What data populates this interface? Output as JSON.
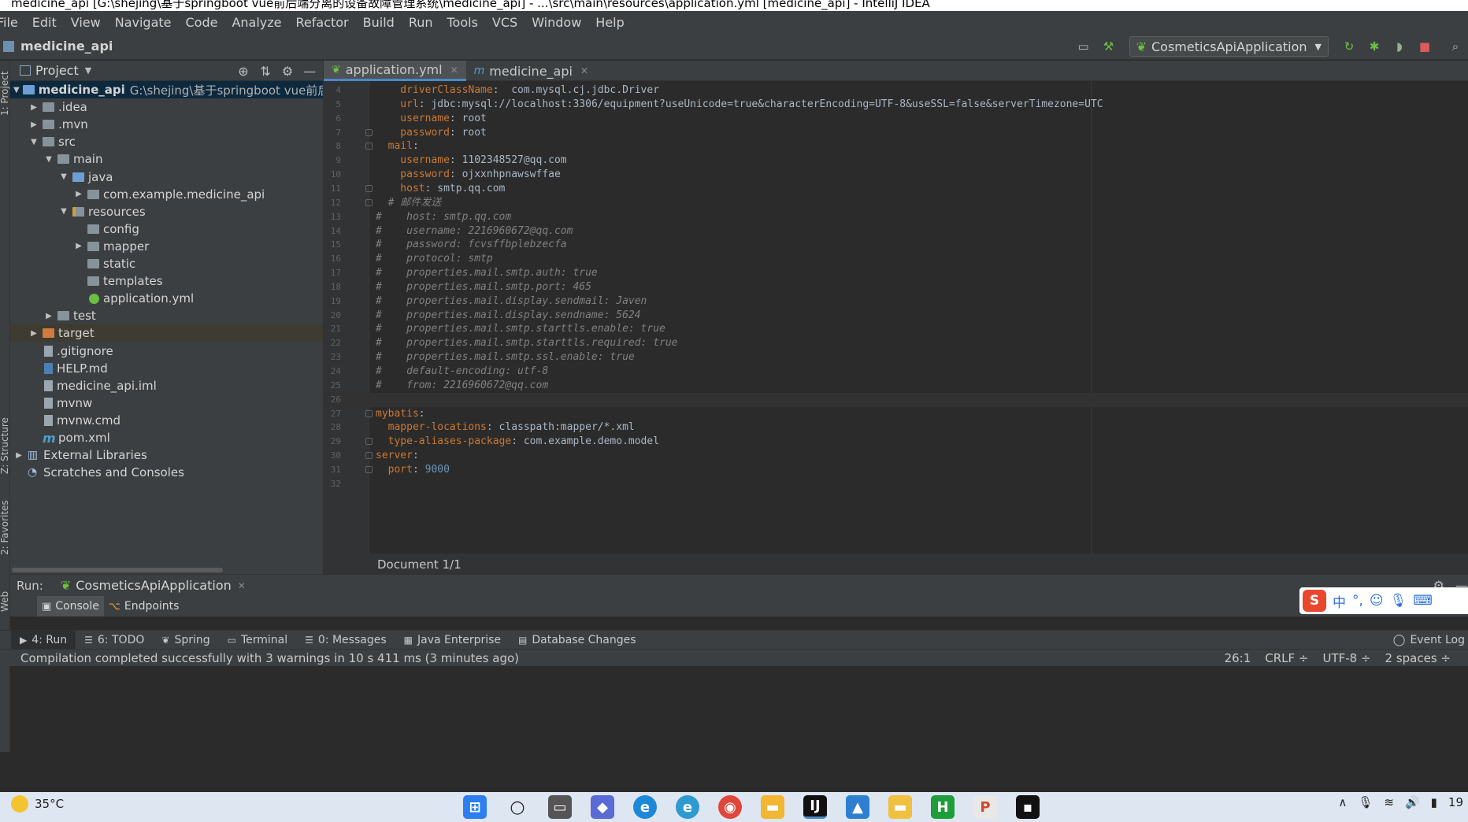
{
  "window": {
    "title": "medicine_api [G:\\shejing\\基于springboot vue前后端分离的设备故障管理系统\\medicine_api] - ...\\src\\main\\resources\\application.yml [medicine_api] - IntelliJ IDEA"
  },
  "menu": [
    "File",
    "Edit",
    "View",
    "Navigate",
    "Code",
    "Analyze",
    "Refactor",
    "Build",
    "Run",
    "Tools",
    "VCS",
    "Window",
    "Help"
  ],
  "nav": {
    "project_name": "medicine_api",
    "run_config": "CosmeticsApiApplication"
  },
  "project_panel": {
    "title": "Project",
    "tree": [
      {
        "label": "medicine_api",
        "path": "G:\\shejing\\基于springboot vue前后端分离的",
        "depth": 0,
        "arrow": "down",
        "icon": "module",
        "selected": true
      },
      {
        "label": ".idea",
        "depth": 1,
        "arrow": "right",
        "icon": "folder"
      },
      {
        "label": ".mvn",
        "depth": 1,
        "arrow": "right",
        "icon": "folder"
      },
      {
        "label": "src",
        "depth": 1,
        "arrow": "down",
        "icon": "folder"
      },
      {
        "label": "main",
        "depth": 2,
        "arrow": "down",
        "icon": "folder"
      },
      {
        "label": "java",
        "depth": 3,
        "arrow": "down",
        "icon": "folder-blue"
      },
      {
        "label": "com.example.medicine_api",
        "depth": 4,
        "arrow": "right",
        "icon": "folder"
      },
      {
        "label": "resources",
        "depth": 3,
        "arrow": "down",
        "icon": "folder-res"
      },
      {
        "label": "config",
        "depth": 4,
        "arrow": "",
        "icon": "folder"
      },
      {
        "label": "mapper",
        "depth": 4,
        "arrow": "right",
        "icon": "folder"
      },
      {
        "label": "static",
        "depth": 4,
        "arrow": "",
        "icon": "folder"
      },
      {
        "label": "templates",
        "depth": 4,
        "arrow": "",
        "icon": "folder"
      },
      {
        "label": "application.yml",
        "depth": 4,
        "arrow": "",
        "icon": "yml"
      },
      {
        "label": "test",
        "depth": 2,
        "arrow": "right",
        "icon": "folder"
      },
      {
        "label": "target",
        "depth": 1,
        "arrow": "right",
        "icon": "folder-orange",
        "highlight": true
      },
      {
        "label": ".gitignore",
        "depth": 1,
        "arrow": "",
        "icon": "file"
      },
      {
        "label": "HELP.md",
        "depth": 1,
        "arrow": "",
        "icon": "md"
      },
      {
        "label": "medicine_api.iml",
        "depth": 1,
        "arrow": "",
        "icon": "file"
      },
      {
        "label": "mvnw",
        "depth": 1,
        "arrow": "",
        "icon": "file"
      },
      {
        "label": "mvnw.cmd",
        "depth": 1,
        "arrow": "",
        "icon": "file"
      },
      {
        "label": "pom.xml",
        "depth": 1,
        "arrow": "",
        "icon": "maven"
      },
      {
        "label": "External Libraries",
        "depth": 0,
        "arrow": "right",
        "icon": "library"
      },
      {
        "label": "Scratches and Consoles",
        "depth": 0,
        "arrow": "",
        "icon": "scratch"
      }
    ]
  },
  "tabs": [
    {
      "label": "application.yml",
      "active": true
    },
    {
      "label": "medicine_api",
      "active": false
    }
  ],
  "editor": {
    "lines": [
      {
        "n": "4",
        "segs": [
          [
            "k",
            "    driverClassName"
          ],
          [
            "v",
            ":  com.mysql.cj.jdbc.Driver"
          ]
        ]
      },
      {
        "n": "5",
        "segs": [
          [
            "k",
            "    url"
          ],
          [
            "v",
            ": jdbc:mysql://localhost:3306/equipment?useUnicode=true&characterEncoding=UTF-8&useSSL=false&serverTimezone=UTC"
          ]
        ]
      },
      {
        "n": "6",
        "segs": [
          [
            "k",
            "    username"
          ],
          [
            "v",
            ": root"
          ]
        ]
      },
      {
        "n": "7",
        "segs": [
          [
            "k",
            "    password"
          ],
          [
            "v",
            ": root"
          ]
        ]
      },
      {
        "n": "8",
        "segs": [
          [
            "k",
            "  mail"
          ],
          [
            "v",
            ":"
          ]
        ]
      },
      {
        "n": "9",
        "segs": [
          [
            "k",
            "    username"
          ],
          [
            "v",
            ": 1102348527@qq.com"
          ]
        ]
      },
      {
        "n": "10",
        "segs": [
          [
            "k",
            "    password"
          ],
          [
            "v",
            ": ojxxnhpnawswffae"
          ]
        ]
      },
      {
        "n": "11",
        "segs": [
          [
            "k",
            "    host"
          ],
          [
            "v",
            ": smtp.qq.com"
          ]
        ]
      },
      {
        "n": "12",
        "segs": [
          [
            "cm",
            "  # 邮件发送"
          ]
        ]
      },
      {
        "n": "13",
        "segs": [
          [
            "cm",
            "#    host: smtp.qq.com"
          ]
        ]
      },
      {
        "n": "14",
        "segs": [
          [
            "cm",
            "#    username: 2216960672@qq.com"
          ]
        ]
      },
      {
        "n": "15",
        "segs": [
          [
            "cm",
            "#    password: fcvsffbplebzecfa"
          ]
        ]
      },
      {
        "n": "16",
        "segs": [
          [
            "cm",
            "#    protocol: smtp"
          ]
        ]
      },
      {
        "n": "17",
        "segs": [
          [
            "cm",
            "#    properties.mail.smtp.auth: true"
          ]
        ]
      },
      {
        "n": "18",
        "segs": [
          [
            "cm",
            "#    properties.mail.smtp.port: 465"
          ]
        ]
      },
      {
        "n": "19",
        "segs": [
          [
            "cm",
            "#    properties.mail.display.sendmail: Javen"
          ]
        ]
      },
      {
        "n": "20",
        "segs": [
          [
            "cm",
            "#    properties.mail.display.sendname: 5624"
          ]
        ]
      },
      {
        "n": "21",
        "segs": [
          [
            "cm",
            "#    properties.mail.smtp.starttls.enable: true"
          ]
        ]
      },
      {
        "n": "22",
        "segs": [
          [
            "cm",
            "#    properties.mail.smtp.starttls.required: true"
          ]
        ]
      },
      {
        "n": "23",
        "segs": [
          [
            "cm",
            "#    properties.mail.smtp.ssl.enable: true"
          ]
        ]
      },
      {
        "n": "24",
        "segs": [
          [
            "cm",
            "#    default-encoding: utf-8"
          ]
        ]
      },
      {
        "n": "25",
        "segs": [
          [
            "cm",
            "#    from: 2216960672@qq.com"
          ]
        ]
      },
      {
        "n": "26",
        "segs": [],
        "current": true
      },
      {
        "n": "27",
        "segs": [
          [
            "k",
            "mybatis"
          ],
          [
            "v",
            ":"
          ]
        ]
      },
      {
        "n": "28",
        "segs": [
          [
            "k",
            "  mapper-locations"
          ],
          [
            "v",
            ": classpath:mapper/*.xml"
          ]
        ]
      },
      {
        "n": "29",
        "segs": [
          [
            "k",
            "  type-aliases-package"
          ],
          [
            "v",
            ": com.example.demo.model"
          ]
        ]
      },
      {
        "n": "30",
        "segs": [
          [
            "k",
            "server"
          ],
          [
            "v",
            ":"
          ]
        ]
      },
      {
        "n": "31",
        "segs": [
          [
            "k",
            "  port"
          ],
          [
            "v",
            ": "
          ],
          [
            "num",
            "9000"
          ]
        ]
      },
      {
        "n": "32",
        "segs": []
      }
    ]
  },
  "breadcrumb": "Document 1/1",
  "run_panel": {
    "label": "Run:",
    "tab": "CosmeticsApiApplication",
    "subtabs": [
      "Console",
      "Endpoints"
    ]
  },
  "tool_tabs": [
    {
      "label": "4: Run",
      "active": true
    },
    {
      "label": "6: TODO"
    },
    {
      "label": "Spring"
    },
    {
      "label": "Terminal"
    },
    {
      "label": "0: Messages"
    },
    {
      "label": "Java Enterprise"
    },
    {
      "label": "Database Changes"
    }
  ],
  "event_log": "Event Log",
  "status": {
    "message": "Compilation completed successfully with 3 warnings in 10 s 411 ms (3 minutes ago)",
    "position": "26:1",
    "line_sep": "CRLF ÷",
    "encoding": "UTF-8 ÷",
    "indent": "2 spaces ÷"
  },
  "side_labels": [
    "1: Project",
    "Z: Structure",
    "2: Favorites",
    "Web"
  ],
  "taskbar": {
    "weather": "35°C",
    "clock": "19"
  }
}
